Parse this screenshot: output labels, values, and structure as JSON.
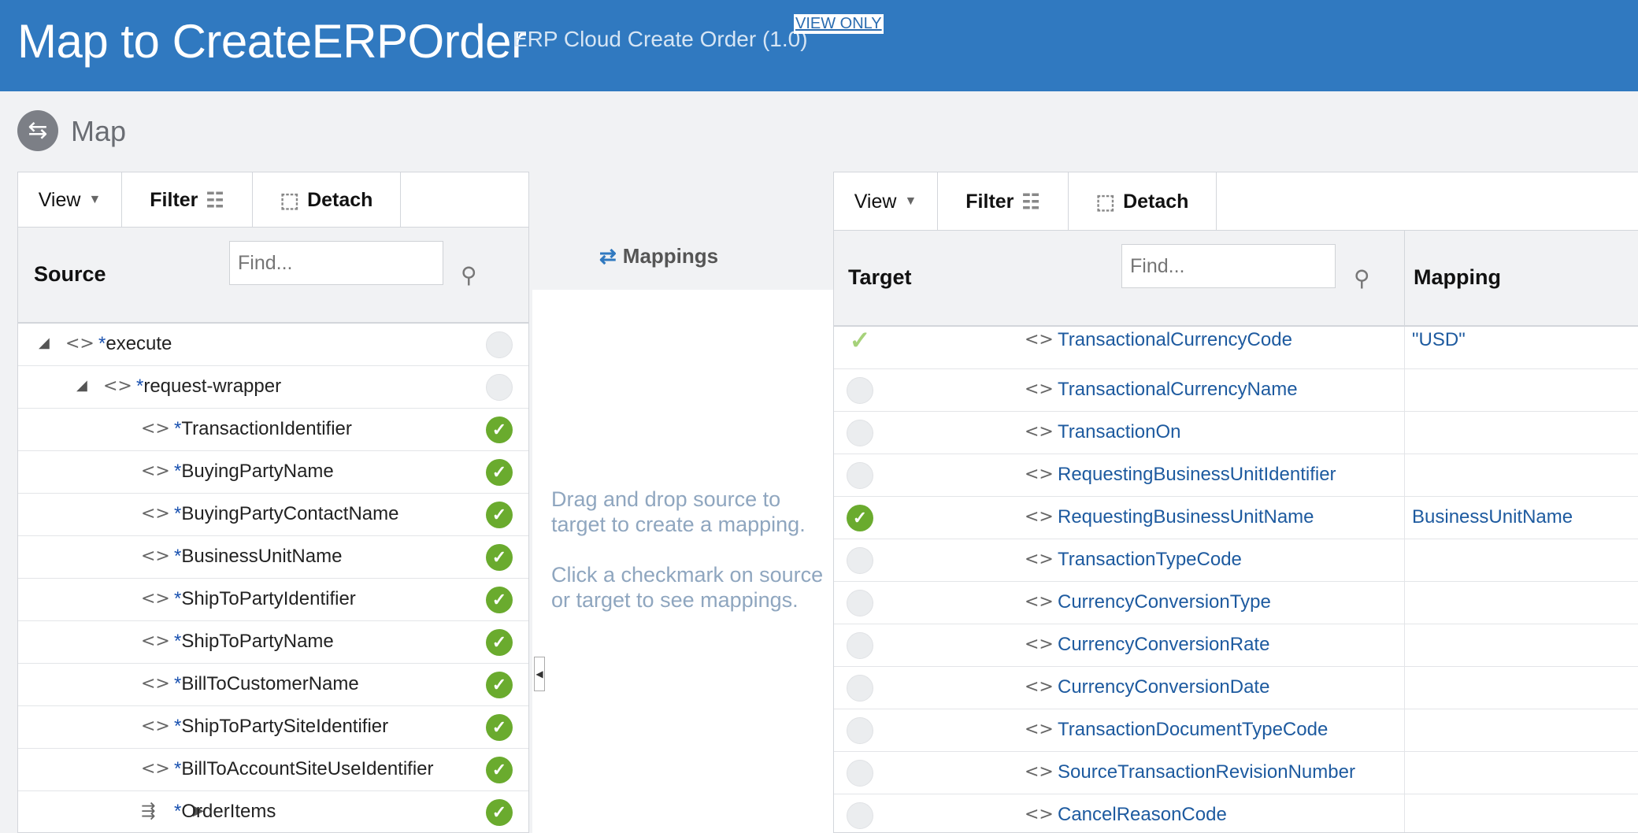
{
  "header": {
    "title": "Map to CreateERPOrder",
    "subtitle": "ERP Cloud Create Order (1.0)",
    "view_only": "VIEW ONLY"
  },
  "map_section": {
    "label": "Map"
  },
  "source_panel": {
    "toolbar": {
      "view": "View",
      "filter": "Filter",
      "detach": "Detach"
    },
    "column_label": "Source",
    "find_placeholder": "Find...",
    "rows": [
      {
        "label": "execute",
        "required": "*",
        "expander": "expanded",
        "mapped": false
      },
      {
        "label": "request-wrapper",
        "required": "*",
        "expander": "expanded",
        "mapped": false
      },
      {
        "label": "TransactionIdentifier",
        "required": "*",
        "mapped": true
      },
      {
        "label": "BuyingPartyName",
        "required": "*",
        "mapped": true
      },
      {
        "label": "BuyingPartyContactName",
        "required": "*",
        "mapped": true
      },
      {
        "label": "BusinessUnitName",
        "required": "*",
        "mapped": true
      },
      {
        "label": "ShipToPartyIdentifier",
        "required": "*",
        "mapped": true
      },
      {
        "label": "ShipToPartyName",
        "required": "*",
        "mapped": true
      },
      {
        "label": "BillToCustomerName",
        "required": "*",
        "mapped": true
      },
      {
        "label": "ShipToPartySiteIdentifier",
        "required": "*",
        "mapped": true
      },
      {
        "label": "BillToAccountSiteUseIdentifier",
        "required": "*",
        "mapped": true
      },
      {
        "label": "OrderItems",
        "required": "*",
        "expander": "collapsed",
        "mapped": true
      }
    ]
  },
  "mappings_panel": {
    "title": "Mappings",
    "hint1": "Drag and drop source to target to create a mapping.",
    "hint2": "Click a checkmark on source or target to see mappings."
  },
  "target_panel": {
    "toolbar": {
      "view": "View",
      "filter": "Filter",
      "detach": "Detach"
    },
    "column_label": "Target",
    "mapping_label": "Mapping",
    "find_placeholder": "Find...",
    "rows": [
      {
        "label": "TransactionalCurrencyCode",
        "status": "light",
        "mapping": "\"USD\""
      },
      {
        "label": "TransactionalCurrencyName",
        "status": "off",
        "mapping": ""
      },
      {
        "label": "TransactionOn",
        "status": "off",
        "mapping": ""
      },
      {
        "label": "RequestingBusinessUnitIdentifier",
        "status": "off",
        "mapping": ""
      },
      {
        "label": "RequestingBusinessUnitName",
        "status": "on",
        "mapping": "BusinessUnitName"
      },
      {
        "label": "TransactionTypeCode",
        "status": "off",
        "mapping": ""
      },
      {
        "label": "CurrencyConversionType",
        "status": "off",
        "mapping": ""
      },
      {
        "label": "CurrencyConversionRate",
        "status": "off",
        "mapping": ""
      },
      {
        "label": "CurrencyConversionDate",
        "status": "off",
        "mapping": ""
      },
      {
        "label": "TransactionDocumentTypeCode",
        "status": "off",
        "mapping": ""
      },
      {
        "label": "SourceTransactionRevisionNumber",
        "status": "off",
        "mapping": ""
      },
      {
        "label": "CancelReasonCode",
        "status": "off",
        "mapping": ""
      }
    ]
  },
  "colors": {
    "header_bg": "#3079c0",
    "mapped_green": "#6aab2e",
    "link_blue": "#1d5a9f"
  },
  "icons": {
    "map": "map-arrows-icon",
    "filter": "filter-icon",
    "detach": "detach-icon",
    "search": "search-icon",
    "element": "element-tag-icon",
    "check": "check-icon"
  }
}
